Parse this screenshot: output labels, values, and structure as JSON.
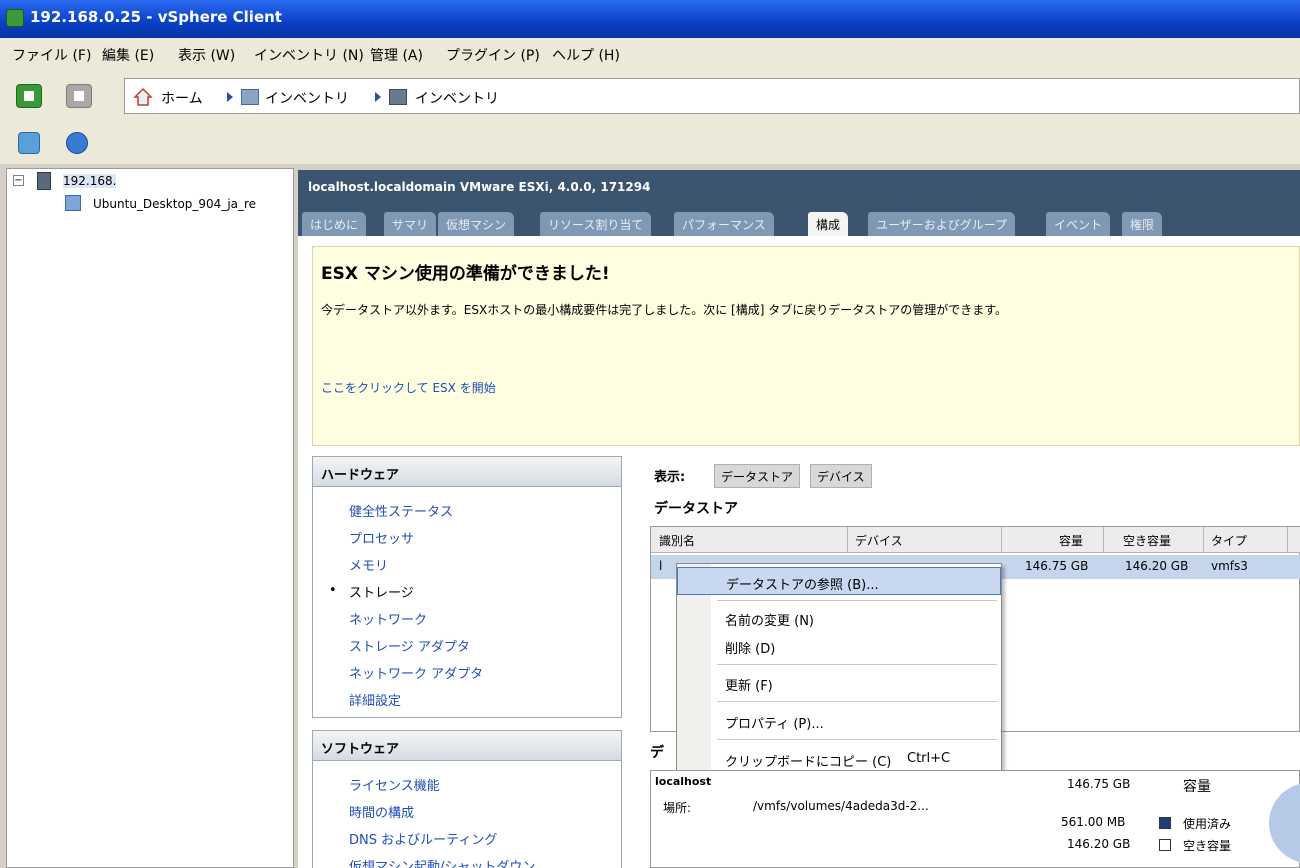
{
  "window": {
    "title": "192.168.0.25 - vSphere Client"
  },
  "menu": [
    "ファイル (F)",
    "編集 (E)",
    "表示 (W)",
    "インベントリ (N)",
    "管理 (A)",
    "プラグイン (P)",
    "ヘルプ (H)"
  ],
  "breadcrumb": {
    "home": "ホーム",
    "item1": "インベントリ",
    "item2": "インベントリ"
  },
  "tree": {
    "host": "192.168.",
    "vm": "Ubuntu_Desktop_904_ja_re"
  },
  "host_header": "localhost.localdomain VMware ESXi, 4.0.0, 171294",
  "tabs": [
    "はじめに",
    "サマリ",
    "仮想マシン",
    "リソース割り当て",
    "パフォーマンス",
    "構成",
    "ユーザーおよびグループ",
    "イベント",
    "権限"
  ],
  "banner": {
    "title": "ESX マシン使用の準備ができました!",
    "desc": "今データストア以外ます。ESXホストの最小構成要件は完了しました。次に [構成] タブに戻りデータストアの管理ができます。",
    "link": "ここをクリックして ESX を開始"
  },
  "hardware": {
    "title": "ハードウェア",
    "items": [
      "健全性ステータス",
      "プロセッサ",
      "メモリ",
      "ストレージ",
      "ネットワーク",
      "ストレージ アダプタ",
      "ネットワーク アダプタ",
      "詳細設定"
    ]
  },
  "software": {
    "title": "ソフトウェア",
    "items": [
      "ライセンス機能",
      "時間の構成",
      "DNS およびルーティング",
      "仮想マシン起動/シャットダウン"
    ]
  },
  "view": {
    "label": "表示:",
    "btn_datastore": "データストア",
    "btn_device": "デバイス"
  },
  "datastore": {
    "title": "データストア",
    "columns": [
      "識別名",
      "デバイス",
      "容量",
      "空き容量",
      "タイプ"
    ],
    "row": {
      "name": "l",
      "capacity": "146.75 GB",
      "free": "146.20 GB",
      "type": "vmfs3"
    }
  },
  "context_menu": {
    "browse": "データストアの参照 (B)...",
    "rename": "名前の変更 (N)",
    "delete": "削除 (D)",
    "refresh": "更新 (F)",
    "properties": "プロパティ (P)...",
    "copy": "クリップボードにコピー (C)",
    "copy_shortcut": "Ctrl+C"
  },
  "details": {
    "stub": "デ",
    "name": "localhost",
    "location_label": "場所:",
    "location_value": "/vmfs/volumes/4adeda3d-2...",
    "capacity": "146.75 GB",
    "capacity_label": "容量",
    "used": "561.00 MB",
    "used_label": "使用済み",
    "free": "146.20 GB",
    "free_label": "空き容量"
  },
  "colors": {
    "title_bar": "#0a3fc4",
    "host_header": "#3b5470",
    "banner_bg": "#fefee0",
    "selection": "#c7d8f0",
    "link": "#1e4eb8"
  }
}
